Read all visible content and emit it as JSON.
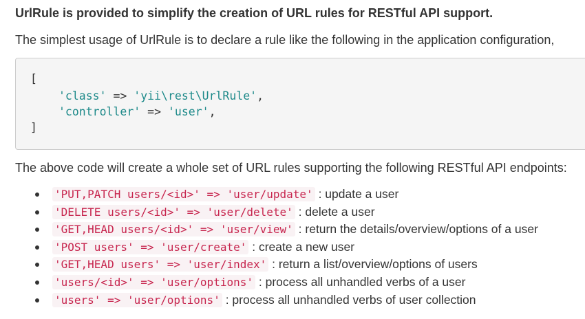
{
  "heading": "UrlRule is provided to simplify the creation of URL rules for RESTful API support.",
  "intro": "The simplest usage of UrlRule is to declare a rule like the following in the application configuration,",
  "code": {
    "open_bracket": "[",
    "close_bracket": "]",
    "lines": [
      {
        "key": "'class'",
        "op": " => ",
        "value": "'yii\\rest\\UrlRule'",
        "tail": ","
      },
      {
        "key": "'controller'",
        "op": " => ",
        "value": "'user'",
        "tail": ","
      }
    ]
  },
  "summary": "The above code will create a whole set of URL rules supporting the following RESTful API endpoints:",
  "endpoints": [
    {
      "code": "'PUT,PATCH users/<id>' => 'user/update'",
      "desc": ": update a user"
    },
    {
      "code": "'DELETE users/<id>' => 'user/delete'",
      "desc": ": delete a user"
    },
    {
      "code": "'GET,HEAD users/<id>' => 'user/view'",
      "desc": ": return the details/overview/options of a user"
    },
    {
      "code": "'POST users' => 'user/create'",
      "desc": ": create a new user"
    },
    {
      "code": "'GET,HEAD users' => 'user/index'",
      "desc": ": return a list/overview/options of users"
    },
    {
      "code": "'users/<id>' => 'user/options'",
      "desc": ": process all unhandled verbs of a user"
    },
    {
      "code": "'users' => 'user/options'",
      "desc": ": process all unhandled verbs of user collection"
    }
  ],
  "colors": {
    "code_string": "#1e8a8a",
    "inline_code_text": "#c7254e",
    "inline_code_bg": "#f9f2f4",
    "codeblock_bg": "#f5f5f5"
  }
}
